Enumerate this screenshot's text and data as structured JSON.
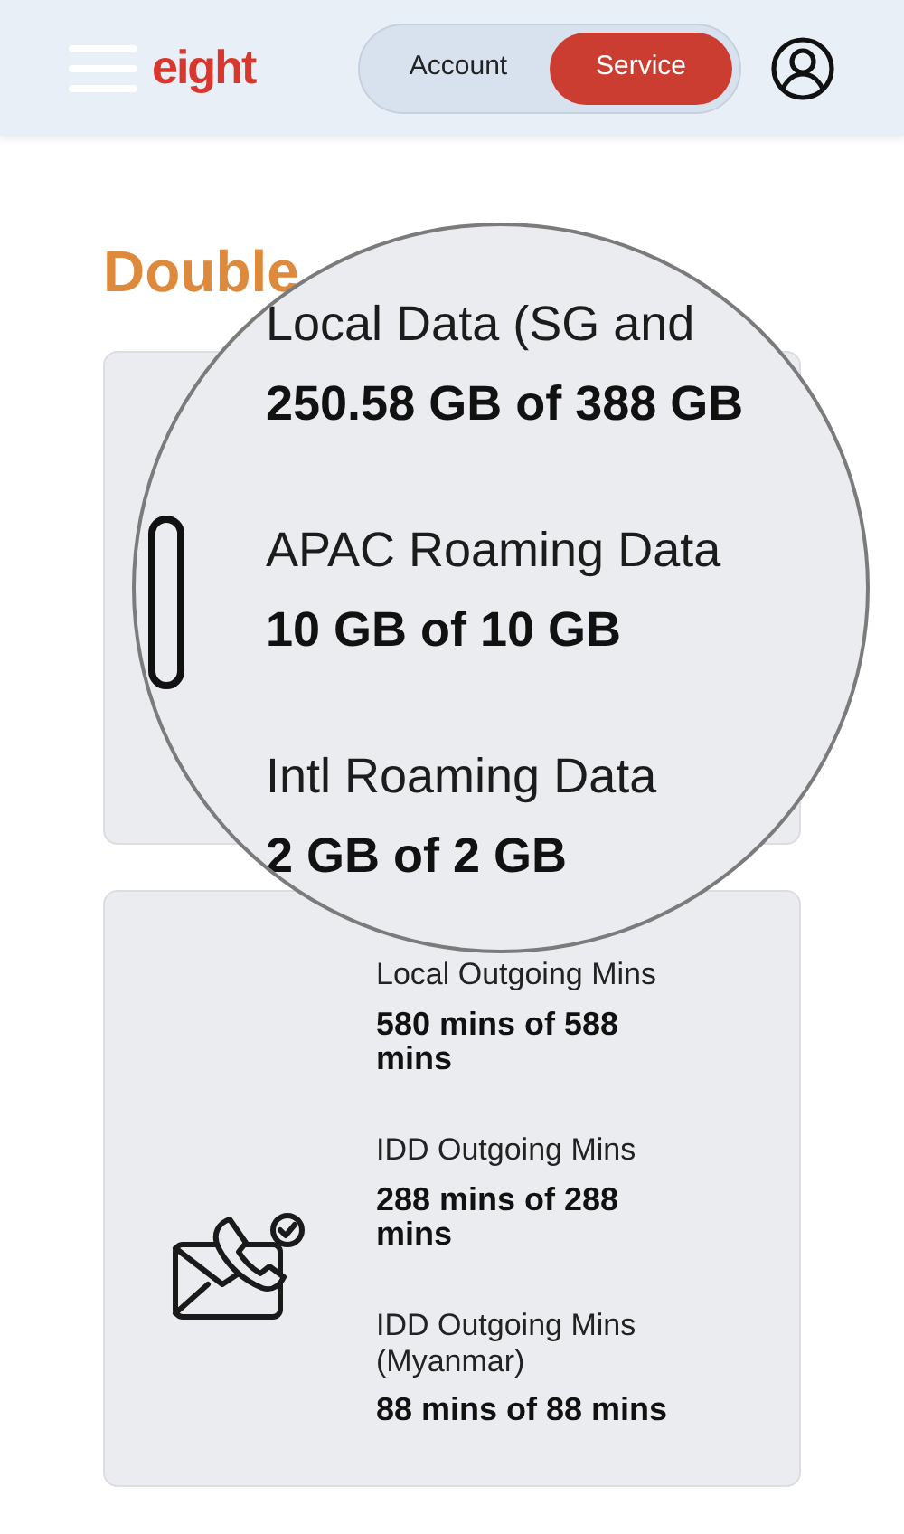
{
  "header": {
    "logo": "eight",
    "toggle": [
      {
        "label": "Account",
        "selected": false
      },
      {
        "label": "Service",
        "selected": true
      }
    ]
  },
  "heading": "Double",
  "magnifier": {
    "items": [
      {
        "label": "Local Data (SG and",
        "value": "250.58 GB of 388 GB"
      },
      {
        "label": "APAC Roaming Data",
        "value": "10 GB of 10 GB"
      },
      {
        "label": "Intl Roaming Data",
        "value": "2 GB of 2 GB"
      }
    ]
  },
  "calls_card": {
    "items": [
      {
        "label": "Local Outgoing Mins",
        "value": "580 mins of 588 mins"
      },
      {
        "label": "IDD Outgoing Mins",
        "value": "288 mins of 288 mins"
      },
      {
        "label": "IDD Outgoing Mins (Myanmar)",
        "value": "88 mins of 88 mins"
      }
    ]
  }
}
